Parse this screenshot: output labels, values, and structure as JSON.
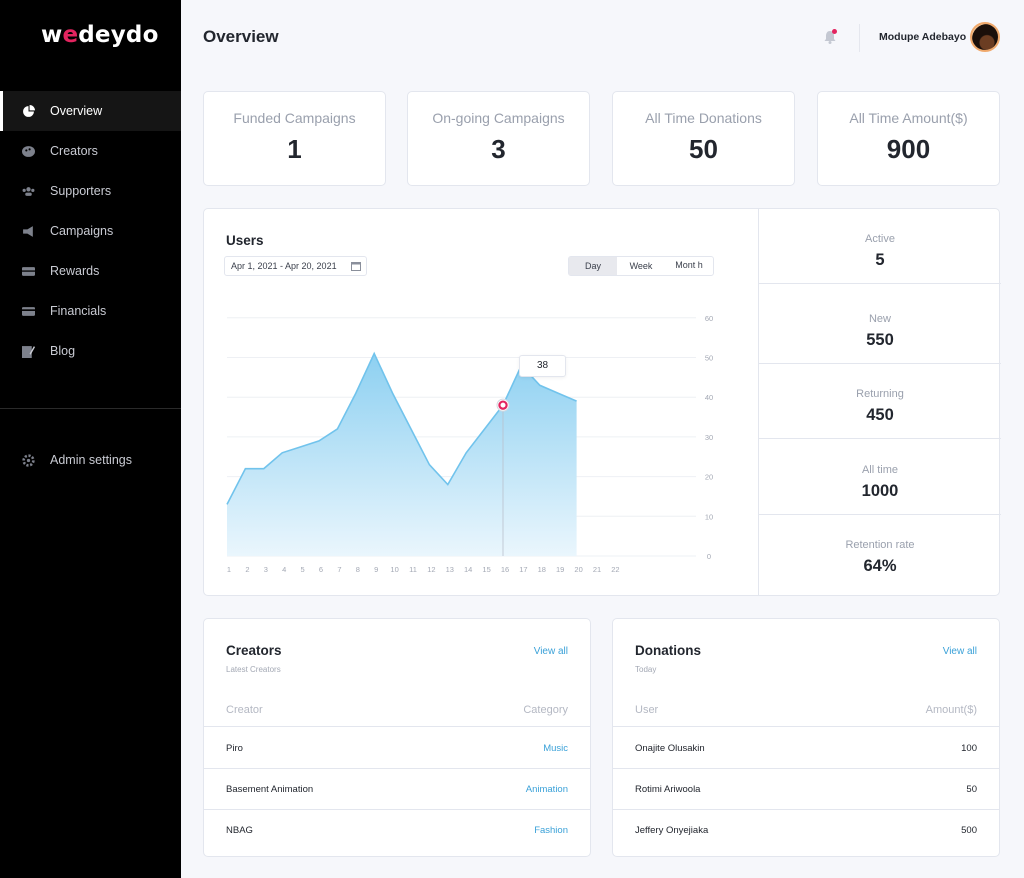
{
  "brand": {
    "logo_pre": "w",
    "logo_mid": "e",
    "logo_post": "deydo",
    "accent": "#e3245f"
  },
  "header": {
    "title": "Overview",
    "user_name": "Modupe Adebayo"
  },
  "sidebar": {
    "items": [
      {
        "label": "Overview",
        "icon": "pie-chart-icon"
      },
      {
        "label": "Creators",
        "icon": "palette-icon"
      },
      {
        "label": "Supporters",
        "icon": "users-icon"
      },
      {
        "label": "Campaigns",
        "icon": "megaphone-icon"
      },
      {
        "label": "Rewards",
        "icon": "gift-card-icon"
      },
      {
        "label": "Financials",
        "icon": "credit-card-icon"
      },
      {
        "label": "Blog",
        "icon": "edit-icon"
      }
    ],
    "settings": {
      "label": "Admin settings",
      "icon": "gear-icon"
    }
  },
  "stats": [
    {
      "label": "Funded Campaigns",
      "value": "1"
    },
    {
      "label": "On-going Campaigns",
      "value": "3"
    },
    {
      "label": "All Time Donations",
      "value": "50"
    },
    {
      "label": "All Time Amount($)",
      "value": "900"
    }
  ],
  "users": {
    "title": "Users",
    "date_range": "Apr 1, 2021 - Apr 20, 2021",
    "periods": [
      "Day",
      "Week",
      "Mont h"
    ],
    "tooltip": "38",
    "metrics": [
      {
        "label": "Active",
        "value": "5"
      },
      {
        "label": "New",
        "value": "550"
      },
      {
        "label": "Returning",
        "value": "450"
      },
      {
        "label": "All time",
        "value": "1000"
      },
      {
        "label": "Retention rate",
        "value": "64%"
      }
    ]
  },
  "chart_data": {
    "type": "area",
    "x": [
      1,
      2,
      3,
      4,
      5,
      6,
      7,
      8,
      9,
      10,
      11,
      12,
      13,
      14,
      15,
      16,
      17,
      18,
      19,
      20
    ],
    "series": [
      {
        "values": [
          13,
          22,
          22,
          26,
          27.5,
          29,
          32,
          41,
          51,
          41,
          32,
          23,
          18,
          26,
          32,
          38,
          48,
          43,
          41,
          39
        ]
      }
    ],
    "x_ticks": [
      "1",
      "2",
      "3",
      "4",
      "5",
      "6",
      "7",
      "8",
      "9",
      "10",
      "11",
      "12",
      "13",
      "14",
      "15",
      "16",
      "17",
      "18",
      "19",
      "20",
      "21",
      "22"
    ],
    "y_ticks": [
      "0",
      "10",
      "20",
      "30",
      "40",
      "50",
      "60"
    ],
    "ylim": [
      0,
      60
    ],
    "highlight": {
      "x": 16,
      "y": 38
    },
    "grid": true,
    "colors": {
      "line": "#71c3ec",
      "fill_top": "#8dd0f1",
      "fill_bottom": "#eaf6fd",
      "marker": "#e3245f"
    }
  },
  "creators": {
    "title": "Creators",
    "subtitle": "Latest Creators",
    "view_all": "View all",
    "columns": [
      "Creator",
      "Category"
    ],
    "rows": [
      {
        "name": "Piro",
        "category": "Music"
      },
      {
        "name": "Basement Animation",
        "category": "Animation"
      },
      {
        "name": "NBAG",
        "category": "Fashion"
      }
    ]
  },
  "donations": {
    "title": "Donations",
    "subtitle": "Today",
    "view_all": "View all",
    "columns": [
      "User",
      "Amount($)"
    ],
    "rows": [
      {
        "user": "Onajite Olusakin",
        "amount": "100"
      },
      {
        "user": "Rotimi Ariwoola",
        "amount": "50"
      },
      {
        "user": "Jeffery Onyejiaka",
        "amount": "500"
      }
    ]
  }
}
